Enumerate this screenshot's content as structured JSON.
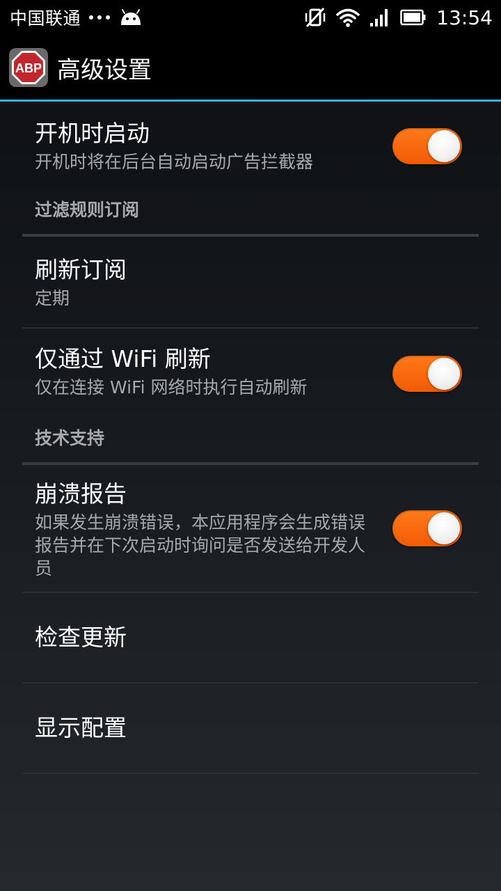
{
  "status_bar": {
    "carrier": "中国联通",
    "time": "13:54",
    "icons": [
      "notification-dots-icon",
      "android-icon",
      "vibrate-off-icon",
      "wifi-icon",
      "signal-icon",
      "battery-icon"
    ]
  },
  "action_bar": {
    "logo_text": "ABP",
    "title": "高级设置"
  },
  "colors": {
    "accent_blue": "#33b5e5",
    "toggle_on": "#f96b10",
    "logo_red": "#c1272d"
  },
  "prefs": {
    "autostart": {
      "title": "开机时启动",
      "summary": "开机时将在后台自动启动广告拦截器",
      "checked": true
    },
    "category_filters": "过滤规则订阅",
    "refresh": {
      "title": "刷新订阅",
      "summary": "定期"
    },
    "wifi_only": {
      "title": "仅通过 WiFi 刷新",
      "summary": "仅在连接 WiFi 网络时执行自动刷新",
      "checked": true
    },
    "category_support": "技术支持",
    "crash_report": {
      "title": "崩溃报告",
      "summary": "如果发生崩溃错误，本应用程序会生成错误报告并在下次启动时询问是否发送给开发人员",
      "checked": true
    },
    "check_update": {
      "title": "检查更新"
    },
    "show_config": {
      "title": "显示配置"
    }
  }
}
